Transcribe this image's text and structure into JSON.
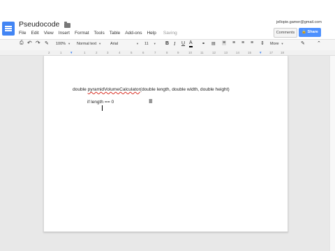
{
  "header": {
    "title": "Pseudocode",
    "user_email": "jellopie.gamer@gmail.com",
    "comments_label": "Comments",
    "share_label": "Share",
    "share_color": "#4d90fe"
  },
  "menu": {
    "items": [
      "File",
      "Edit",
      "View",
      "Insert",
      "Format",
      "Tools",
      "Table",
      "Add-ons",
      "Help"
    ],
    "status": "Saving"
  },
  "toolbar": {
    "zoom": "100%",
    "style": "Normal text",
    "font": "Arial",
    "size": "11",
    "more": "More"
  },
  "ruler": {
    "ticks": [
      "2",
      "1",
      "1",
      "2",
      "3",
      "4",
      "5",
      "6",
      "7",
      "8",
      "9",
      "10",
      "11",
      "12",
      "13",
      "14",
      "15",
      "16",
      "17",
      "18"
    ]
  },
  "document": {
    "line1_pre": "double ",
    "line1_misspelled": "pyramidVolumeCalculator",
    "line1_post": "(double length, double width, double height)",
    "line2": "if length == 0"
  },
  "icons": [
    "print-icon",
    "undo-icon",
    "redo-icon",
    "paint-format-icon",
    "bold-icon",
    "italic-icon",
    "underline-icon",
    "text-color-icon",
    "link-icon",
    "comment-icon",
    "align-left-icon",
    "align-center-icon",
    "align-right-icon",
    "justify-icon",
    "line-spacing-icon",
    "numbered-list-icon",
    "bulleted-list-icon",
    "pen-icon",
    "collapse-icon",
    "docs-logo-icon",
    "folder-icon"
  ]
}
